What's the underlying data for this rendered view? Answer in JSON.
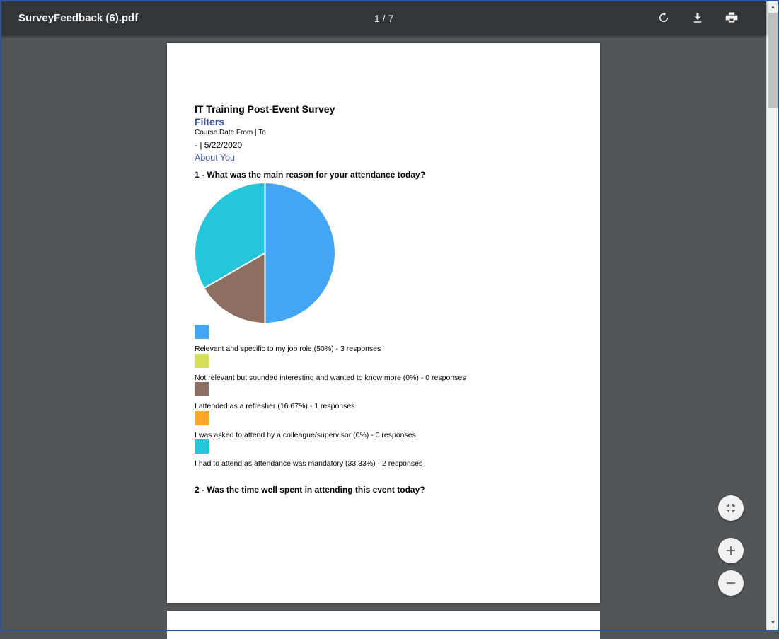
{
  "toolbar": {
    "title": "SurveyFeedback (6).pdf",
    "page_indicator": "1 / 7",
    "icons": [
      "rotate-icon",
      "download-icon",
      "print-icon"
    ]
  },
  "document": {
    "title": "IT Training Post-Event Survey",
    "filters_heading": "Filters",
    "course_date_label": "Course Date From | To",
    "course_date_value": "- | 5/22/2020",
    "section": "About You",
    "question1": "1 - What was the main reason for your attendance today?",
    "question2": "2 - Was the time well spent in attending this event today?"
  },
  "chart_data": {
    "type": "pie",
    "categories": [
      "Relevant and specific to my job role (50%) - 3 responses",
      "Not relevant but sounded interesting and wanted to know more (0%) - 0 responses",
      "I attended as a refresher (16.67%) - 1 responses",
      "I was asked to attend by a colleague/supervisor (0%) - 0 responses",
      "I had to attend as attendance was mandatory (33.33%) - 2 responses"
    ],
    "values": [
      3,
      0,
      1,
      0,
      2
    ],
    "colors": [
      "#42a5f5",
      "#d4e157",
      "#8d6e63",
      "#ffa726",
      "#26c6da"
    ]
  },
  "zoom_controls": {
    "icons": [
      "fit-page-icon",
      "zoom-in-icon",
      "zoom-out-icon"
    ]
  }
}
